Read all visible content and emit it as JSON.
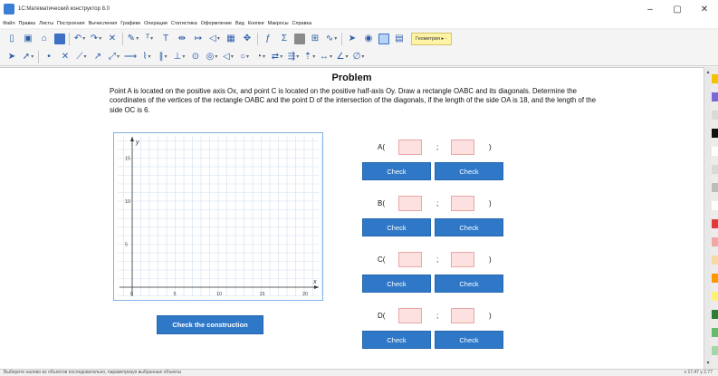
{
  "window": {
    "title": "1С:Математический конструктор 8.0",
    "controls": [
      "–",
      "▢",
      "✕"
    ]
  },
  "menu": [
    "Файл",
    "Правка",
    "Листы",
    "Построения",
    "Вычисления",
    "Графики",
    "Операции",
    "Статистика",
    "Оформление",
    "Вид",
    "Кнопки",
    "Макросы",
    "Справка"
  ],
  "toolbar": {
    "geometry_label": "Геометрия ▸ ·"
  },
  "problem": {
    "title": "Problem",
    "text": "Point A is located on the positive axis Ox, and point C is located on the positive half-axis Oy. Draw a rectangle OABC and its diagonals. Determine the coordinates of the vertices of the rectangle OABC and the point D of the intersection of the diagonals, if the length of the side OA is 18, and the length of the side OC is 6."
  },
  "graph": {
    "x_axis_label": "x",
    "y_axis_label": "y",
    "x_ticks": [
      "0",
      "5",
      "10",
      "15",
      "20"
    ],
    "y_ticks": [
      "5",
      "10",
      "15"
    ],
    "grid": true
  },
  "answers": [
    {
      "label": "A(",
      "semicolon": ";",
      "close": ")",
      "check1": "Check",
      "check2": "Check"
    },
    {
      "label": "B(",
      "semicolon": ";",
      "close": ")",
      "check1": "Check",
      "check2": "Check"
    },
    {
      "label": "C(",
      "semicolon": ";",
      "close": ")",
      "check1": "Check",
      "check2": "Check"
    },
    {
      "label": "D(",
      "semicolon": ";",
      "close": ")",
      "check1": "Check",
      "check2": "Check"
    }
  ],
  "check_construction_label": "Check the construction",
  "status": {
    "text": "Выберите налево из объектов последовательно, параметризуя выбранные объекты",
    "coords": "x 17.47 y 2.77"
  },
  "palette_colors": [
    "#f2c200",
    "#7a6ad8",
    "#d9d9d9",
    "#111111",
    "#ffffff",
    "#d9d9d9",
    "#bdbdbd",
    "#ffffff",
    "#e53935",
    "#f4a6a6",
    "#f7d9a6",
    "#ff9800",
    "#fff176",
    "#2e7d32",
    "#66bb6a",
    "#a5d6a7"
  ],
  "colors": {
    "button_blue": "#2f78c8",
    "input_pink": "#fde0e0",
    "graph_border": "#7fb3e3"
  }
}
